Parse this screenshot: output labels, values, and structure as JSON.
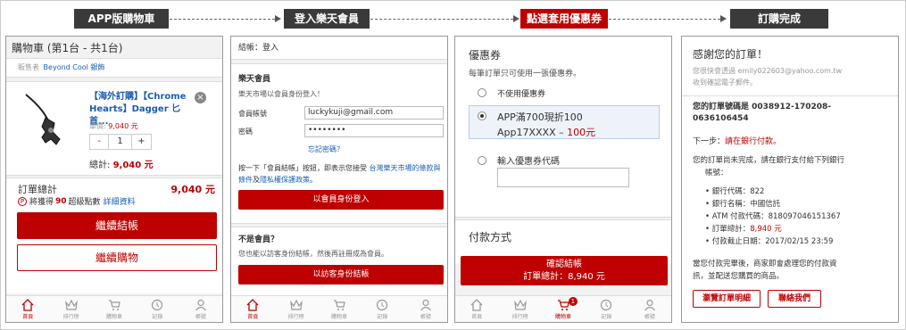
{
  "steps": [
    {
      "label": "APP版購物車",
      "color": "#3a3a3a"
    },
    {
      "label": "登入樂天會員",
      "color": "#3a3a3a"
    },
    {
      "label": "點選套用優惠券",
      "color": "#bf0000"
    },
    {
      "label": "訂購完成",
      "color": "#3a3a3a"
    }
  ],
  "tabs": [
    "首頁",
    "排行榜",
    "購物車",
    "記錄",
    "帳號"
  ],
  "cart": {
    "title": "購物車 (第1台 - 共1台)",
    "seller_label": "販售者",
    "seller_name": "Beyond Cool 銀飾",
    "product_name": "【海外訂購】【Chrome Hearts】Dagger 匕首...",
    "unit_price_label": "單價:",
    "unit_price": "9,040 元",
    "qty_minus": "-",
    "qty": "1",
    "qty_plus": "+",
    "subtotal_label": "總計:",
    "subtotal": "9,040 元",
    "order_total_label": "訂單總計",
    "order_total": "9,040 元",
    "points_icon": "P",
    "points_prefix": "將獲得",
    "points_value": "90",
    "points_suffix": "超級點數",
    "points_link": "詳細資料",
    "checkout_button": "繼續結帳",
    "continue_button": "繼續購物"
  },
  "login": {
    "header": "結帳：登入",
    "member_title": "樂天會員",
    "member_desc": "樂天市場以會員身份登入！",
    "account_label": "會員帳號",
    "account_value": "luckykuji@gmail.com",
    "password_label": "密碼",
    "password_value": "••••••••",
    "forgot": "忘記密碼？",
    "terms_1": "按一下「會員結帳」按鈕，即表示您接受",
    "terms_link1": "台灣樂天市場的條款與條件",
    "terms_and": "及",
    "terms_link2": "隱私權保護政策",
    "terms_end": "。",
    "login_button": "以會員身份登入",
    "guest_title": "不是會員？",
    "guest_desc": "您也能以訪客身份結帳，然後再註冊成為會員。",
    "guest_button": "以訪客身份結帳"
  },
  "coupon": {
    "title": "優惠券",
    "note": "每筆訂單只可使用一張優惠券。",
    "opt_none": "不使用優惠券",
    "opt_selected_line1": "APP滿700現折100",
    "opt_selected_code": "App17XXXX – ",
    "opt_selected_amount": "100元",
    "opt_input": "輸入優惠券代碼",
    "payment_title": "付款方式",
    "confirm_button": "確認結帳",
    "confirm_total": "訂單總計：8,940 元",
    "cart_badge": "1"
  },
  "done": {
    "title": "感謝您的訂單！",
    "email_note_1": "您很快會透過 emily022603@yahoo.com.tw",
    "email_note_2": "收到確認電子郵件。",
    "order_no_1": "您的訂單號碼是 0038912-170208-",
    "order_no_2": "0636106454",
    "next_label": "下一步：",
    "next_value": "請在銀行付款。",
    "incomplete_1": "您的訂單尚未完成，請在銀行支付給下列銀行",
    "incomplete_2": "帳號：",
    "bank_items": [
      {
        "label": "銀行代碼：822",
        "red": false
      },
      {
        "label": "銀行名稱：中國信託",
        "red": false
      },
      {
        "label": "ATM 付款代碼：818097046151367",
        "red": false
      },
      {
        "label": "訂單總計：",
        "value": "8,940 元",
        "red": true
      },
      {
        "label": "付款截止日期：2017/02/15 23:59",
        "red": false
      }
    ],
    "after_1": "當您付款完畢後，商家即會處理您的付款資",
    "after_2": "訊，並配送您購買的商品。",
    "view_button": "瀏覽訂單明細",
    "contact_button": "聯絡我們"
  }
}
